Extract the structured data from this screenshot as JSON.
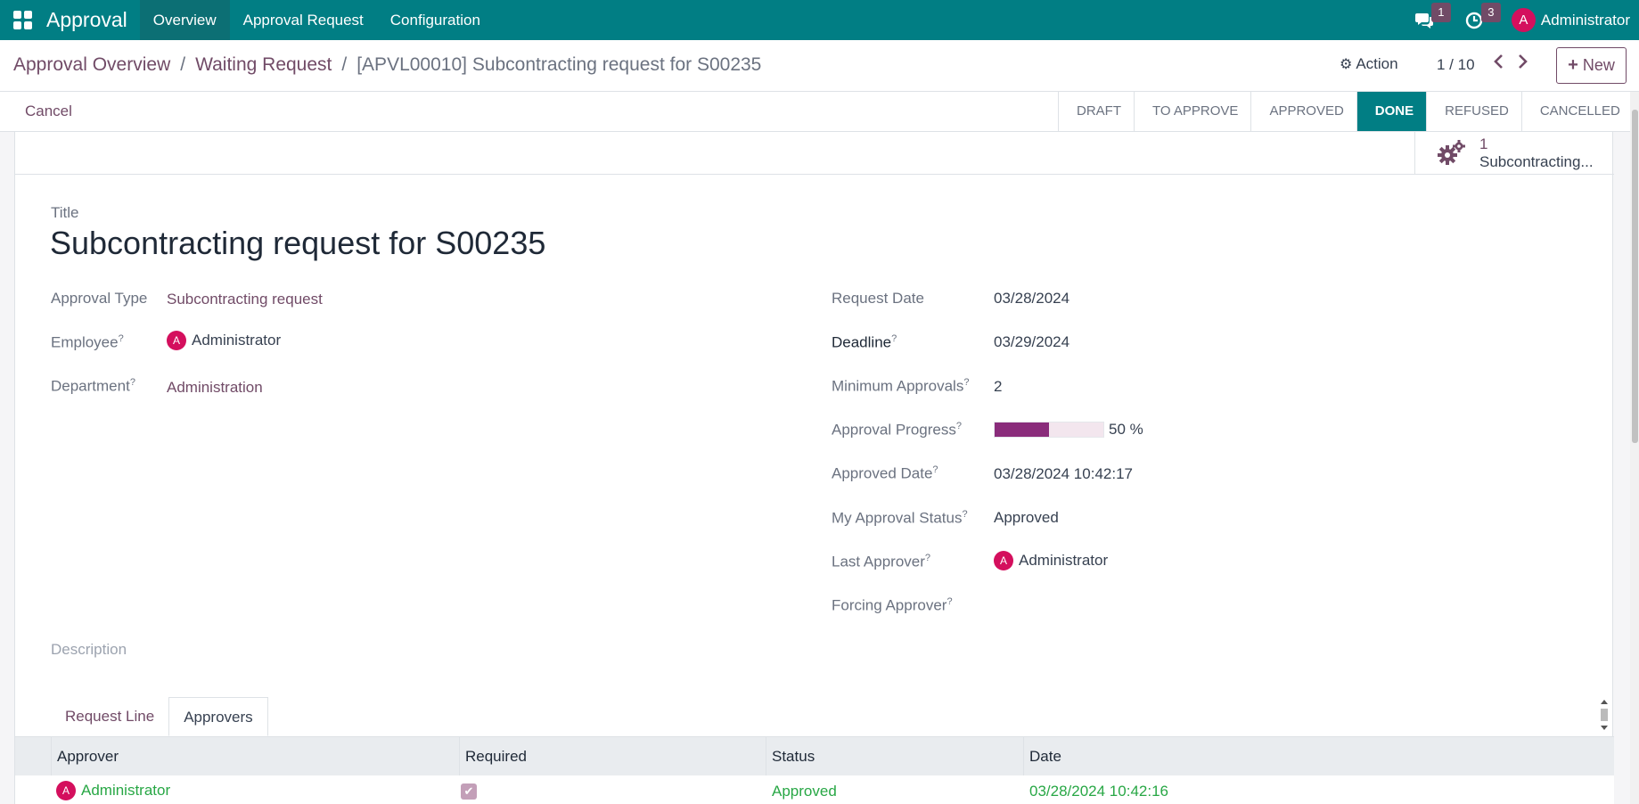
{
  "app": {
    "brand": "Approval",
    "menu": [
      "Overview",
      "Approval Request",
      "Configuration"
    ],
    "messages_badge": "1",
    "activities_badge": "3",
    "user_initial": "A",
    "user_name": "Administrator"
  },
  "breadcrumb": {
    "items": [
      "Approval Overview",
      "Waiting Request"
    ],
    "current": "[APVL00010] Subcontracting request for S00235"
  },
  "control": {
    "action_label": "Action",
    "pager": "1 / 10",
    "new_label": "New"
  },
  "status": {
    "cancel_label": "Cancel",
    "stages": [
      "DRAFT",
      "TO APPROVE",
      "APPROVED",
      "DONE",
      "REFUSED",
      "CANCELLED"
    ],
    "active_stage": "DONE"
  },
  "smart_button": {
    "count": "1",
    "label": "Subcontracting..."
  },
  "form": {
    "title_label": "Title",
    "title_value": "Subcontracting request for S00235",
    "left_fields": {
      "approval_type_label": "Approval Type",
      "approval_type_value": "Subcontracting request",
      "employee_label": "Employee",
      "employee_value": "Administrator",
      "department_label": "Department",
      "department_value": "Administration"
    },
    "right_fields": {
      "request_date_label": "Request Date",
      "request_date_value": "03/28/2024",
      "deadline_label": "Deadline",
      "deadline_value": "03/29/2024",
      "min_approvals_label": "Minimum Approvals",
      "min_approvals_value": "2",
      "progress_label": "Approval Progress",
      "progress_value": 0.5,
      "progress_text": "50 %",
      "approved_date_label": "Approved Date",
      "approved_date_value": "03/28/2024 10:42:17",
      "my_status_label": "My Approval Status",
      "my_status_value": "Approved",
      "last_approver_label": "Last Approver",
      "last_approver_value": "Administrator",
      "forcing_approver_label": "Forcing Approver"
    },
    "description_label": "Description"
  },
  "tabs": [
    "Request Line",
    "Approvers"
  ],
  "approvers_table": {
    "headers": [
      "Approver",
      "Required",
      "Status",
      "Date"
    ],
    "rows": [
      {
        "approver": "Administrator",
        "required": true,
        "status": "Approved",
        "date": "03/28/2024 10:42:16"
      }
    ]
  },
  "colors": {
    "topbar": "#017e84",
    "primary": "#714b67",
    "success": "#28a745",
    "avatar": "#d40f5d"
  }
}
